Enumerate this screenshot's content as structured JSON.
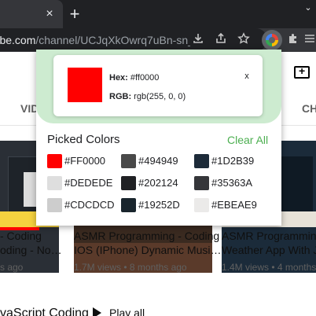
{
  "browser": {
    "tab_close_glyph": "×",
    "new_tab_glyph": "+",
    "tab_chevron_glyph": "⌄",
    "url_host": "utube.com",
    "url_path": "/channel/UCJqXkOwrq7uBn-sn_",
    "icons": [
      "download-icon",
      "share-icon",
      "bookmark-star-icon",
      "color-picker-extension-icon",
      "extensions-puzzle-icon",
      "menu-icon"
    ]
  },
  "youtube": {
    "nav_left": "VID",
    "nav_right": "CH",
    "videos": [
      {
        "title_line1": "- Coding",
        "title_line2": "oding - No…",
        "meta": "s ago"
      },
      {
        "title_line1": "ASMR Programming - Coding",
        "title_line2": "IOS (IPhone) Dynamic Musi…",
        "meta": "1.7M views • 8 months ago"
      },
      {
        "title_line1": "ASMR Programming -",
        "title_line2": "Weather App With Jav",
        "meta": "1.4M views • 4 months ago"
      }
    ],
    "section_title": "vaScript Coding",
    "play_all": "Play all"
  },
  "picker": {
    "current": {
      "hex_label": "Hex:",
      "hex_value": "#ff0000",
      "rgb_label": "RGB:",
      "rgb_value": "rgb(255, 0, 0)",
      "color": "#ff0000",
      "close_label": "x"
    },
    "picked_title": "Picked Colors",
    "clear_all": "Clear All",
    "colors": [
      {
        "hex": "#FF0000",
        "color": "#ff0000"
      },
      {
        "hex": "#494949",
        "color": "#494949"
      },
      {
        "hex": "#1D2B39",
        "color": "#1d2b39"
      },
      {
        "hex": "#DEDEDE",
        "color": "#dedede"
      },
      {
        "hex": "#202124",
        "color": "#202124"
      },
      {
        "hex": "#35363A",
        "color": "#35363a"
      },
      {
        "hex": "#CDCDCD",
        "color": "#cdcdcd"
      },
      {
        "hex": "#19252D",
        "color": "#19252d"
      },
      {
        "hex": "#EBEAE9",
        "color": "#ebeae9"
      }
    ],
    "accent_color": "#cdebd0",
    "clear_color": "#4caf50"
  }
}
